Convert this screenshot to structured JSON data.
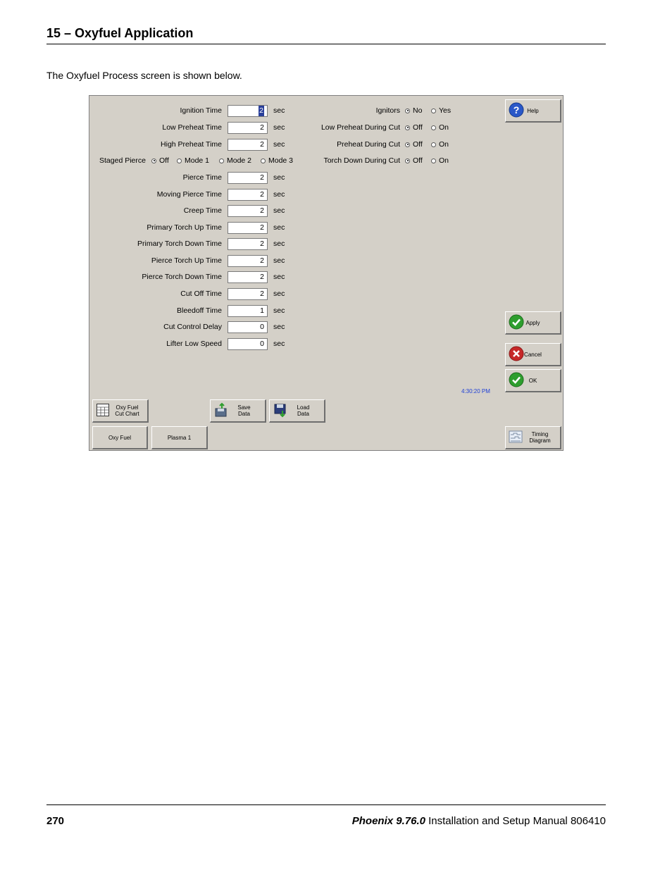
{
  "header": {
    "title": "15 – Oxyfuel Application"
  },
  "intro": "The Oxyfuel Process screen is shown below.",
  "screen": {
    "unit": "sec",
    "fields": [
      {
        "label": "Ignition Time",
        "value": "2"
      },
      {
        "label": "Low Preheat Time",
        "value": "2"
      },
      {
        "label": "High Preheat Time",
        "value": "2"
      },
      {
        "label": "Pierce Time",
        "value": "2"
      },
      {
        "label": "Moving Pierce Time",
        "value": "2"
      },
      {
        "label": "Creep Time",
        "value": "2"
      },
      {
        "label": "Primary Torch Up Time",
        "value": "2"
      },
      {
        "label": "Primary Torch Down Time",
        "value": "2"
      },
      {
        "label": "Pierce Torch Up Time",
        "value": "2"
      },
      {
        "label": "Pierce Torch Down Time",
        "value": "2"
      },
      {
        "label": "Cut Off Time",
        "value": "2"
      },
      {
        "label": "Bleedoff Time",
        "value": "1"
      },
      {
        "label": "Cut Control Delay",
        "value": "0"
      },
      {
        "label": "Lifter Low Speed",
        "value": "0"
      }
    ],
    "staged_pierce": {
      "label": "Staged Pierce",
      "options": [
        "Off",
        "Mode 1",
        "Mode 2",
        "Mode 3"
      ],
      "selected": "Off"
    },
    "right_options": [
      {
        "label": "Ignitors",
        "options": [
          "No",
          "Yes"
        ],
        "selected": "No"
      },
      {
        "label": "Low Preheat During Cut",
        "options": [
          "Off",
          "On"
        ],
        "selected": "Off"
      },
      {
        "label": "Preheat During Cut",
        "options": [
          "Off",
          "On"
        ],
        "selected": "Off"
      },
      {
        "label": "Torch Down During Cut",
        "options": [
          "Off",
          "On"
        ],
        "selected": "Off"
      }
    ],
    "buttons": {
      "help": "Help",
      "apply": "Apply",
      "cancel": "Cancel",
      "ok": "OK",
      "oxy_fuel_cut_chart": "Oxy Fuel\nCut Chart",
      "save_data": "Save\nData",
      "load_data": "Load\nData",
      "oxy_fuel": "Oxy Fuel",
      "plasma_1": "Plasma 1",
      "timing_diagram": "Timing\nDiagram"
    },
    "clock": "4:30:20 PM"
  },
  "footer": {
    "page": "270",
    "product": "Phoenix 9.76.0",
    "manual": "Installation and Setup Manual",
    "doc_number": "806410"
  },
  "colors": {
    "panel": "#d4d0c8",
    "clock": "#1e3fd6",
    "apply_ok": "#2e9e2e",
    "cancel": "#c62828",
    "help": "#2a58c8"
  }
}
